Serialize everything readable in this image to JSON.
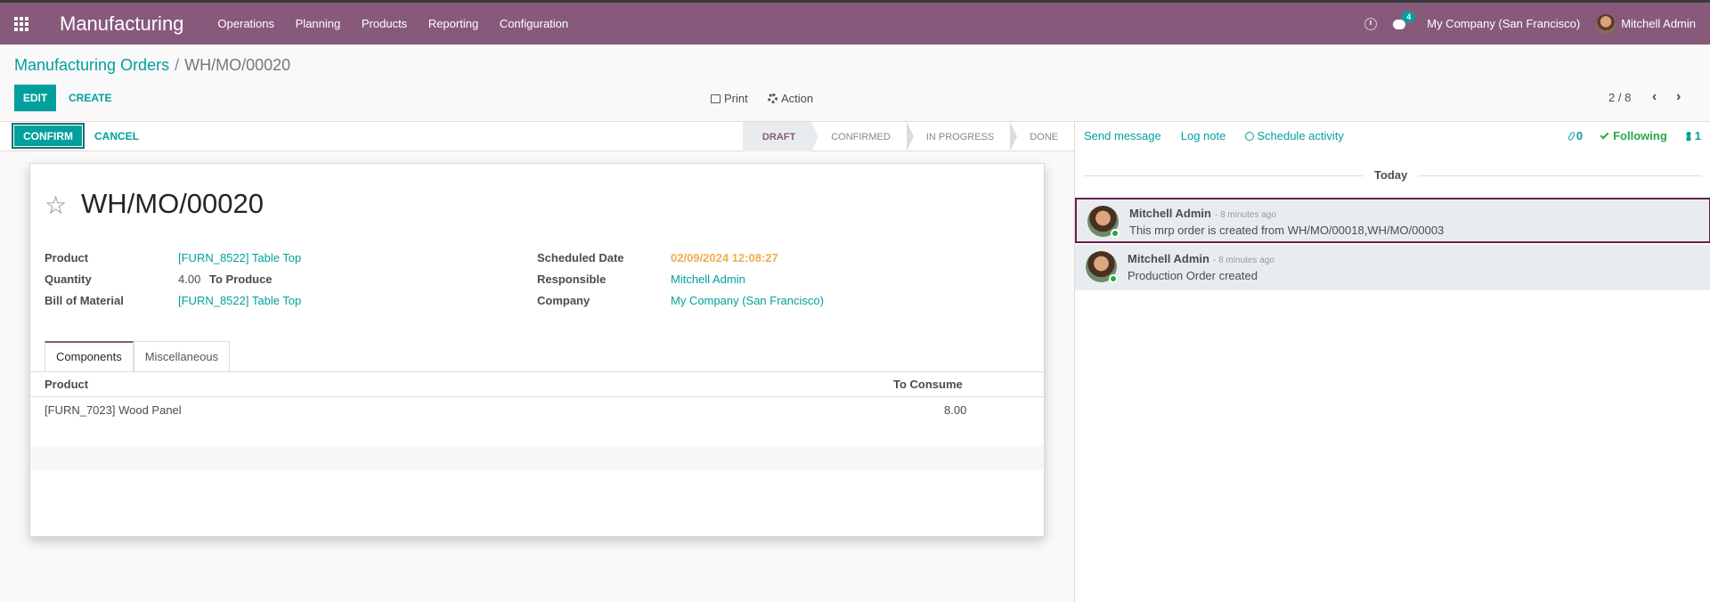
{
  "topbar": {
    "app_name": "Manufacturing",
    "menu": [
      "Operations",
      "Planning",
      "Products",
      "Reporting",
      "Configuration"
    ],
    "chat_count": "4",
    "company": "My Company (San Francisco)",
    "user": "Mitchell Admin",
    "accent": "#875a7b"
  },
  "breadcrumb": {
    "parent": "Manufacturing Orders",
    "separator": "/",
    "current": "WH/MO/00020"
  },
  "control": {
    "edit": "EDIT",
    "create": "CREATE",
    "print": "Print",
    "action": "Action",
    "pager": "2 / 8",
    "prev": "‹",
    "next": "›"
  },
  "statusbar": {
    "confirm": "CONFIRM",
    "cancel": "CANCEL",
    "stages": [
      "DRAFT",
      "CONFIRMED",
      "IN PROGRESS",
      "DONE"
    ],
    "active_stage": "DRAFT"
  },
  "form": {
    "title": "WH/MO/00020",
    "product_label": "Product",
    "product_value": "[FURN_8522] Table Top",
    "quantity_label": "Quantity",
    "quantity_value": "4.00",
    "to_produce": "To Produce",
    "bom_label": "Bill of Material",
    "bom_value": "[FURN_8522] Table Top",
    "scheduled_label": "Scheduled Date",
    "scheduled_value": "02/09/2024 12:08:27",
    "responsible_label": "Responsible",
    "responsible_value": "Mitchell Admin",
    "company_label": "Company",
    "company_value": "My Company (San Francisco)",
    "tabs": [
      "Components",
      "Miscellaneous"
    ],
    "table": {
      "headers": [
        "Product",
        "To Consume"
      ],
      "rows": [
        {
          "product": "[FURN_7023] Wood Panel",
          "qty": "8.00"
        }
      ]
    }
  },
  "chatter": {
    "send_message": "Send message",
    "log_note": "Log note",
    "schedule_activity": "Schedule activity",
    "attachments": "0",
    "following": "Following",
    "followers": "1",
    "today": "Today",
    "messages": [
      {
        "author": "Mitchell Admin",
        "time": "- 8 minutes ago",
        "body": "This mrp order is created from WH/MO/00018,WH/MO/00003"
      },
      {
        "author": "Mitchell Admin",
        "time": "- 8 minutes ago",
        "body": "Production Order created"
      }
    ]
  }
}
